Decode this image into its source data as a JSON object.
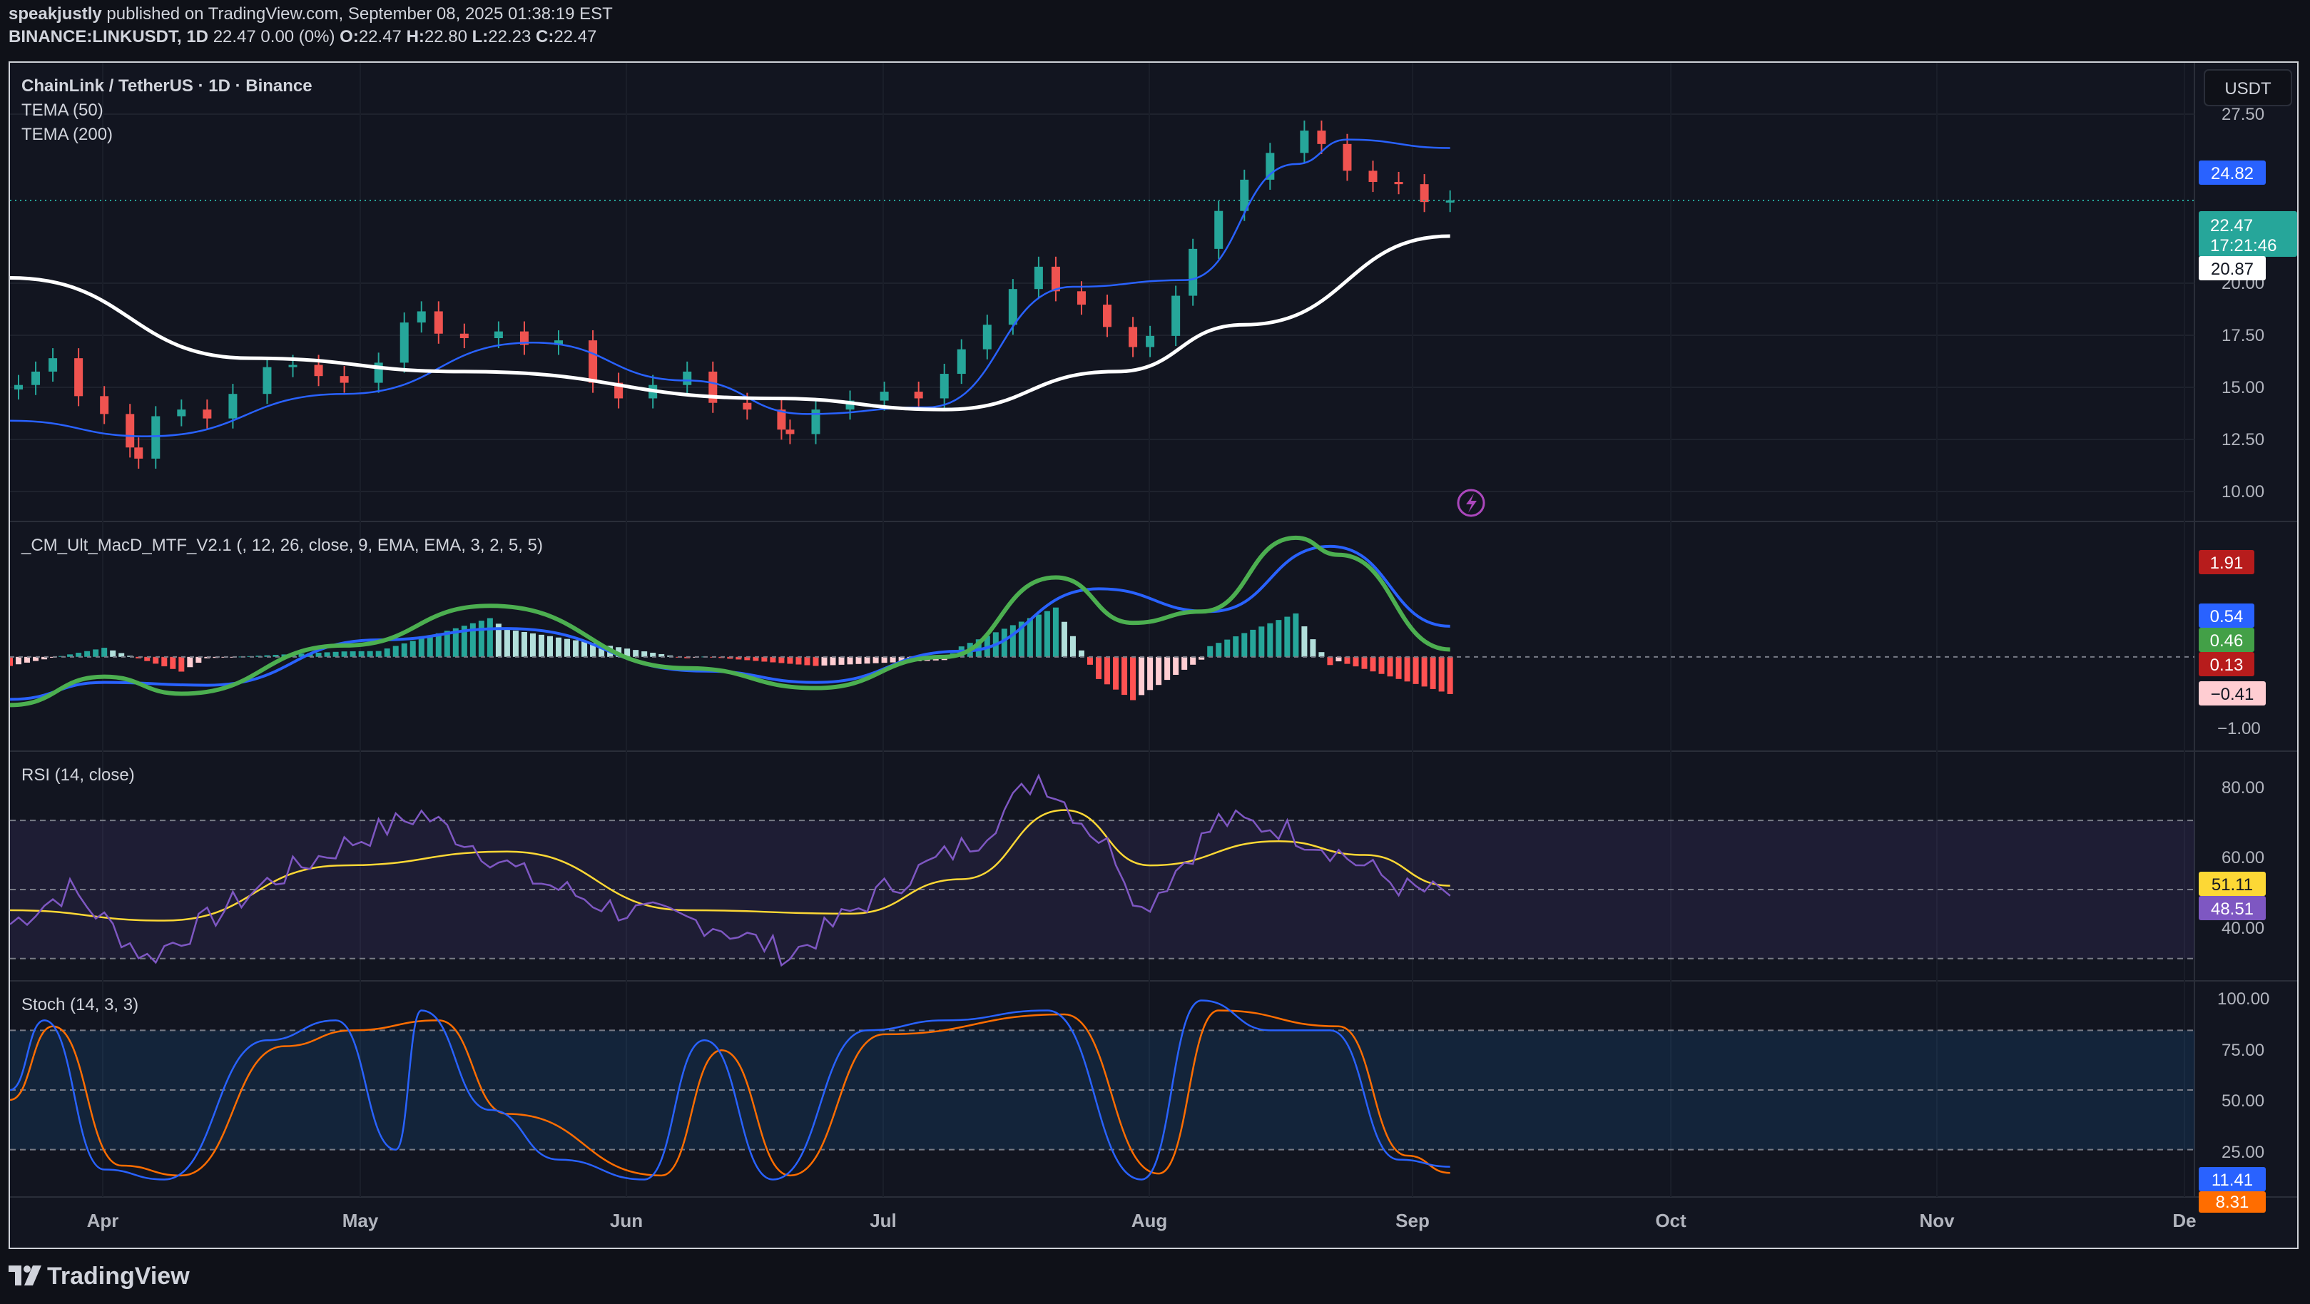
{
  "header": {
    "user": "speakjustly",
    "published_text": "published on TradingView.com, September 08, 2025 01:38:19 EST",
    "symbol": "BINANCE:LINKUSDT, 1D",
    "last": "22.47",
    "change": "0.00 (0%)",
    "o_label": "O:",
    "o": "22.47",
    "h_label": "H:",
    "h": "22.80",
    "l_label": "L:",
    "l": "22.23",
    "c_label": "C:",
    "c": "22.47"
  },
  "main_pane": {
    "title": "ChainLink / TetherUS · 1D · Binance",
    "indicators": [
      "TEMA (50)",
      "TEMA (200)"
    ],
    "currency_button": "USDT",
    "axis_ticks": [
      "27.50",
      "20.00",
      "17.50",
      "15.00",
      "12.50",
      "10.00"
    ],
    "price_tags": {
      "tema50": "24.82",
      "last_price": "22.47",
      "countdown": "17:21:46",
      "tema200": "20.87"
    }
  },
  "macd_pane": {
    "title": "_CM_Ult_MacD_MTF_V2.1 (, 12, 26, close, 9, EMA, EMA, 3, 2, 5, 5)",
    "axis_ticks": [
      "−1.00"
    ],
    "tags": [
      "1.91",
      "0.54",
      "0.46",
      "0.13",
      "−0.41"
    ]
  },
  "rsi_pane": {
    "title": "RSI (14, close)",
    "axis_ticks": [
      "80.00",
      "60.00",
      "40.00"
    ],
    "tags": [
      "51.11",
      "48.51"
    ]
  },
  "stoch_pane": {
    "title": "Stoch (14, 3, 3)",
    "axis_ticks": [
      "100.00",
      "75.00",
      "50.00",
      "25.00"
    ],
    "tags": [
      "11.41",
      "8.31"
    ]
  },
  "time_axis": [
    "Apr",
    "May",
    "Jun",
    "Jul",
    "Aug",
    "Sep",
    "Oct",
    "Nov",
    "De"
  ],
  "footer": {
    "brand": "TradingView"
  },
  "colors": {
    "bg": "#121520",
    "up": "#26a69a",
    "down": "#ef5350",
    "tema50": "#2962ff",
    "tema200": "#ffffff",
    "macd_green": "#4caf50",
    "macd_red": "#d32f2f",
    "signal": "#2962ff",
    "rsi": "#7e57c2",
    "rsi_ma": "#fdd835",
    "stoch_k": "#2962ff",
    "stoch_d": "#ff6d00"
  },
  "chart_data": [
    {
      "type": "candlestick",
      "title": "ChainLink / TetherUS · 1D · Binance",
      "ylabel": "USDT",
      "ylim": [
        8.5,
        28
      ],
      "x_range": [
        "2025-03-23",
        "2025-12-01"
      ],
      "candles_x": [
        "2025-03-24",
        "2025-03-26",
        "2025-03-28",
        "2025-03-31",
        "2025-04-03",
        "2025-04-06",
        "2025-04-07",
        "2025-04-09",
        "2025-04-12",
        "2025-04-15",
        "2025-04-18",
        "2025-04-22",
        "2025-04-25",
        "2025-04-28",
        "2025-05-01",
        "2025-05-05",
        "2025-05-08",
        "2025-05-10",
        "2025-05-12",
        "2025-05-15",
        "2025-05-19",
        "2025-05-22",
        "2025-05-26",
        "2025-05-30",
        "2025-06-02",
        "2025-06-06",
        "2025-06-10",
        "2025-06-13",
        "2025-06-17",
        "2025-06-21",
        "2025-06-22",
        "2025-06-25",
        "2025-06-29",
        "2025-07-03",
        "2025-07-07",
        "2025-07-10",
        "2025-07-12",
        "2025-07-15",
        "2025-07-18",
        "2025-07-21",
        "2025-07-23",
        "2025-07-26",
        "2025-07-29",
        "2025-08-01",
        "2025-08-03",
        "2025-08-06",
        "2025-08-08",
        "2025-08-11",
        "2025-08-14",
        "2025-08-17",
        "2025-08-21",
        "2025-08-23",
        "2025-08-26",
        "2025-08-29",
        "2025-09-01",
        "2025-09-04",
        "2025-09-07"
      ],
      "candles_close": [
        14.2,
        14.8,
        15.4,
        13.7,
        12.9,
        11.4,
        10.9,
        12.8,
        13.1,
        12.7,
        13.8,
        15.0,
        15.1,
        14.6,
        14.3,
        15.2,
        17.0,
        17.5,
        16.5,
        16.3,
        16.6,
        16.0,
        16.2,
        14.3,
        13.6,
        14.2,
        14.8,
        13.4,
        13.1,
        12.2,
        12.0,
        13.1,
        13.5,
        13.9,
        13.6,
        14.7,
        15.8,
        16.9,
        18.5,
        19.5,
        18.4,
        17.8,
        16.8,
        15.9,
        16.4,
        18.2,
        20.3,
        22.0,
        23.4,
        24.6,
        25.6,
        25.0,
        23.8,
        23.3,
        23.2,
        22.4,
        22.47
      ],
      "tema50": [
        {
          "x": "2025-03-23",
          "y": 12.6
        },
        {
          "x": "2025-04-08",
          "y": 11.9
        },
        {
          "x": "2025-05-01",
          "y": 13.8
        },
        {
          "x": "2025-05-23",
          "y": 16.1
        },
        {
          "x": "2025-06-10",
          "y": 14.4
        },
        {
          "x": "2025-06-24",
          "y": 12.9
        },
        {
          "x": "2025-07-08",
          "y": 13.2
        },
        {
          "x": "2025-07-25",
          "y": 18.6
        },
        {
          "x": "2025-08-07",
          "y": 18.9
        },
        {
          "x": "2025-08-20",
          "y": 24.1
        },
        {
          "x": "2025-08-26",
          "y": 25.2
        },
        {
          "x": "2025-09-07",
          "y": 24.82
        }
      ],
      "tema200": [
        {
          "x": "2025-03-23",
          "y": 19.0
        },
        {
          "x": "2025-04-20",
          "y": 15.4
        },
        {
          "x": "2025-05-15",
          "y": 14.8
        },
        {
          "x": "2025-06-20",
          "y": 13.6
        },
        {
          "x": "2025-07-10",
          "y": 13.1
        },
        {
          "x": "2025-07-30",
          "y": 14.8
        },
        {
          "x": "2025-08-14",
          "y": 16.9
        },
        {
          "x": "2025-09-07",
          "y": 20.87
        }
      ]
    },
    {
      "type": "line",
      "title": "_CM_Ult_MacD_MTF_V2.1 (, 12, 26, close, 9, EMA, EMA, 3, 2, 5, 5)",
      "ylim": [
        -1.6,
        2.3
      ],
      "series": [
        {
          "values": [
            {
              "x": "2025-03-23",
              "y": -0.85
            },
            {
              "x": "2025-04-03",
              "y": -0.35
            },
            {
              "x": "2025-04-12",
              "y": -0.65
            },
            {
              "x": "2025-05-01",
              "y": 0.2
            },
            {
              "x": "2025-05-18",
              "y": 0.9
            },
            {
              "x": "2025-06-10",
              "y": -0.2
            },
            {
              "x": "2025-06-25",
              "y": -0.55
            },
            {
              "x": "2025-07-10",
              "y": 0.0
            },
            {
              "x": "2025-07-23",
              "y": 1.4
            },
            {
              "x": "2025-08-01",
              "y": 0.6
            },
            {
              "x": "2025-08-09",
              "y": 0.8
            },
            {
              "x": "2025-08-20",
              "y": 2.1
            },
            {
              "x": "2025-08-25",
              "y": 1.8
            },
            {
              "x": "2025-09-07",
              "y": 0.13
            }
          ]
        },
        {
          "values": [
            {
              "x": "2025-03-23",
              "y": -0.75
            },
            {
              "x": "2025-04-03",
              "y": -0.45
            },
            {
              "x": "2025-04-15",
              "y": -0.5
            },
            {
              "x": "2025-05-05",
              "y": 0.3
            },
            {
              "x": "2025-05-20",
              "y": 0.5
            },
            {
              "x": "2025-06-12",
              "y": -0.25
            },
            {
              "x": "2025-06-25",
              "y": -0.45
            },
            {
              "x": "2025-07-12",
              "y": 0.1
            },
            {
              "x": "2025-07-28",
              "y": 1.2
            },
            {
              "x": "2025-08-10",
              "y": 0.8
            },
            {
              "x": "2025-08-24",
              "y": 1.95
            },
            {
              "x": "2025-09-07",
              "y": 0.54
            }
          ]
        }
      ]
    },
    {
      "type": "line",
      "title": "RSI (14, close)",
      "ylim": [
        25,
        88
      ],
      "bands": [
        30,
        50,
        70
      ],
      "series": [
        {
          "values": [
            {
              "x": "2025-03-23",
              "y": 40
            },
            {
              "x": "2025-03-30",
              "y": 50
            },
            {
              "x": "2025-04-08",
              "y": 30
            },
            {
              "x": "2025-04-22",
              "y": 52
            },
            {
              "x": "2025-05-01",
              "y": 63
            },
            {
              "x": "2025-05-10",
              "y": 72
            },
            {
              "x": "2025-05-22",
              "y": 54
            },
            {
              "x": "2025-06-02",
              "y": 44
            },
            {
              "x": "2025-06-13",
              "y": 40
            },
            {
              "x": "2025-06-22",
              "y": 31
            },
            {
              "x": "2025-07-03",
              "y": 50
            },
            {
              "x": "2025-07-14",
              "y": 65
            },
            {
              "x": "2025-07-21",
              "y": 83
            },
            {
              "x": "2025-07-30",
              "y": 60
            },
            {
              "x": "2025-08-02",
              "y": 44
            },
            {
              "x": "2025-08-11",
              "y": 70
            },
            {
              "x": "2025-08-18",
              "y": 68
            },
            {
              "x": "2025-08-24",
              "y": 62
            },
            {
              "x": "2025-09-02",
              "y": 50
            },
            {
              "x": "2025-09-07",
              "y": 48.51
            }
          ]
        },
        {
          "values": [
            {
              "x": "2025-03-23",
              "y": 44
            },
            {
              "x": "2025-04-10",
              "y": 41
            },
            {
              "x": "2025-05-01",
              "y": 57
            },
            {
              "x": "2025-05-20",
              "y": 61
            },
            {
              "x": "2025-06-10",
              "y": 44
            },
            {
              "x": "2025-06-29",
              "y": 43
            },
            {
              "x": "2025-07-12",
              "y": 53
            },
            {
              "x": "2025-07-24",
              "y": 73
            },
            {
              "x": "2025-08-03",
              "y": 57
            },
            {
              "x": "2025-08-18",
              "y": 64
            },
            {
              "x": "2025-08-28",
              "y": 60
            },
            {
              "x": "2025-09-07",
              "y": 51.11
            }
          ]
        }
      ]
    },
    {
      "type": "line",
      "title": "Stoch (14, 3, 3)",
      "ylim": [
        -2,
        102
      ],
      "bands": [
        20,
        50,
        80
      ],
      "series": [
        {
          "values": [
            {
              "x": "2025-03-23",
              "y": 50
            },
            {
              "x": "2025-03-27",
              "y": 85
            },
            {
              "x": "2025-04-03",
              "y": 10
            },
            {
              "x": "2025-04-10",
              "y": 5
            },
            {
              "x": "2025-04-22",
              "y": 75
            },
            {
              "x": "2025-04-30",
              "y": 85
            },
            {
              "x": "2025-05-07",
              "y": 20
            },
            {
              "x": "2025-05-10",
              "y": 90
            },
            {
              "x": "2025-05-18",
              "y": 40
            },
            {
              "x": "2025-05-26",
              "y": 15
            },
            {
              "x": "2025-06-05",
              "y": 5
            },
            {
              "x": "2025-06-12",
              "y": 75
            },
            {
              "x": "2025-06-20",
              "y": 5
            },
            {
              "x": "2025-07-01",
              "y": 80
            },
            {
              "x": "2025-07-10",
              "y": 85
            },
            {
              "x": "2025-07-22",
              "y": 90
            },
            {
              "x": "2025-08-02",
              "y": 5
            },
            {
              "x": "2025-08-09",
              "y": 95
            },
            {
              "x": "2025-08-17",
              "y": 80
            },
            {
              "x": "2025-08-24",
              "y": 80
            },
            {
              "x": "2025-09-01",
              "y": 15
            },
            {
              "x": "2025-09-07",
              "y": 11.41
            }
          ]
        },
        {
          "values": [
            {
              "x": "2025-03-23",
              "y": 45
            },
            {
              "x": "2025-03-28",
              "y": 82
            },
            {
              "x": "2025-04-05",
              "y": 12
            },
            {
              "x": "2025-04-12",
              "y": 7
            },
            {
              "x": "2025-04-24",
              "y": 72
            },
            {
              "x": "2025-05-02",
              "y": 80
            },
            {
              "x": "2025-05-12",
              "y": 85
            },
            {
              "x": "2025-05-20",
              "y": 38
            },
            {
              "x": "2025-06-07",
              "y": 7
            },
            {
              "x": "2025-06-14",
              "y": 70
            },
            {
              "x": "2025-06-22",
              "y": 7
            },
            {
              "x": "2025-07-03",
              "y": 78
            },
            {
              "x": "2025-07-24",
              "y": 88
            },
            {
              "x": "2025-08-04",
              "y": 8
            },
            {
              "x": "2025-08-11",
              "y": 90
            },
            {
              "x": "2025-08-25",
              "y": 82
            },
            {
              "x": "2025-09-02",
              "y": 17
            },
            {
              "x": "2025-09-07",
              "y": 8.31
            }
          ]
        }
      ]
    }
  ]
}
